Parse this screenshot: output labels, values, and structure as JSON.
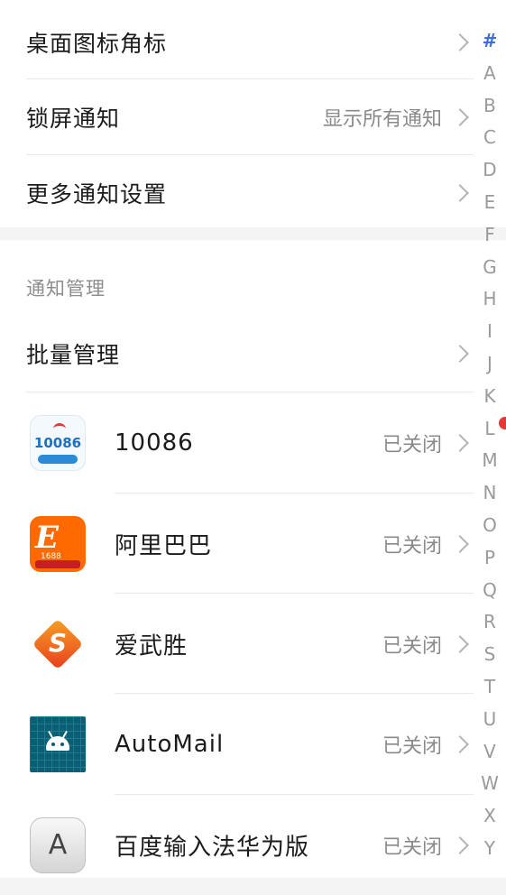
{
  "settings": [
    {
      "label": "桌面图标角标",
      "value": ""
    },
    {
      "label": "锁屏通知",
      "value": "显示所有通知"
    },
    {
      "label": "更多通知设置",
      "value": ""
    }
  ],
  "notification_management": {
    "title": "通知管理",
    "batch_label": "批量管理",
    "apps": [
      {
        "name": "10086",
        "status": "已关闭",
        "icon": "10086-app-icon"
      },
      {
        "name": "阿里巴巴",
        "status": "已关闭",
        "icon": "alibaba-app-icon"
      },
      {
        "name": "爱武胜",
        "status": "已关闭",
        "icon": "aiwusheng-app-icon"
      },
      {
        "name": "AutoMail",
        "status": "已关闭",
        "icon": "android-app-icon"
      },
      {
        "name": "百度输入法华为版",
        "status": "已关闭",
        "icon": "baidu-input-app-icon"
      }
    ]
  },
  "icon_text": {
    "app_10086": "10086",
    "alibaba": "E",
    "alibaba_sub": "1688",
    "aiwusheng": "S",
    "baidu": "A"
  },
  "alpha_index": [
    "#",
    "A",
    "B",
    "C",
    "D",
    "E",
    "F",
    "G",
    "H",
    "I",
    "J",
    "K",
    "L",
    "M",
    "N",
    "O",
    "P",
    "Q",
    "R",
    "S",
    "T",
    "U",
    "V",
    "W",
    "X",
    "Y"
  ],
  "colors": {
    "accent": "#3f6fd6",
    "marker": "#e53935"
  }
}
